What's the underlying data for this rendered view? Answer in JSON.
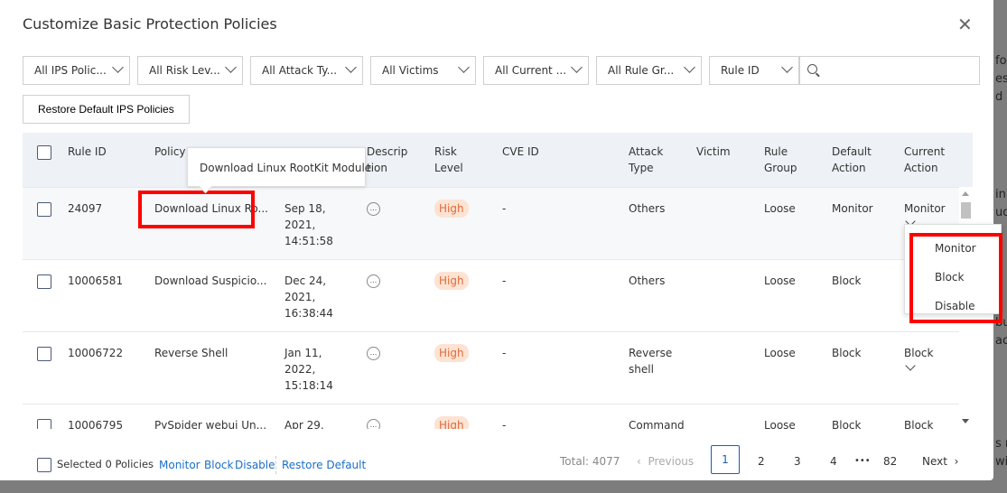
{
  "background_fragments": [
    "for",
    "es",
    "d I",
    "in",
    "ud",
    "bu",
    "ac",
    "s r",
    "wi"
  ],
  "dialog": {
    "title": "Customize Basic Protection Policies",
    "close_icon": "close-icon"
  },
  "filters": [
    "All IPS Polic...",
    "All Risk Lev...",
    "All Attack Ty...",
    "All Victims",
    "All Current ...",
    "All Rule Gr...",
    "Rule ID"
  ],
  "search": {
    "placeholder": ""
  },
  "restore_button": "Restore Default IPS Policies",
  "table": {
    "headers": {
      "rule_id": "Rule ID",
      "policy_name": "Policy N",
      "description_1": "Descrip",
      "description_2": "tion",
      "risk_1": "Risk",
      "risk_2": "Level",
      "cve": "CVE ID",
      "attack_1": "Attack",
      "attack_2": "Type",
      "victim": "Victim",
      "group_1": "Rule",
      "group_2": "Group",
      "default_1": "Default",
      "default_2": "Action",
      "current_1": "Current",
      "current_2": "Action"
    },
    "rows": [
      {
        "rule_id": "24097",
        "policy_name": "Download Linux Ro...",
        "date_1": "Sep 18,",
        "date_2": "2021,",
        "date_3": "14:51:58",
        "desc": "...",
        "risk": "High",
        "cve": "-",
        "attack_1": "Others",
        "attack_2": "",
        "victim": "",
        "group": "Loose",
        "default_action": "Monitor",
        "current_action": "Monitor"
      },
      {
        "rule_id": "10006581",
        "policy_name": "Download Suspicio...",
        "date_1": "Dec 24,",
        "date_2": "2021,",
        "date_3": "16:38:44",
        "desc": "...",
        "risk": "High",
        "cve": "-",
        "attack_1": "Others",
        "attack_2": "",
        "victim": "",
        "group": "Loose",
        "default_action": "Block",
        "current_action": ""
      },
      {
        "rule_id": "10006722",
        "policy_name": "Reverse Shell",
        "date_1": "Jan 11,",
        "date_2": "2022,",
        "date_3": "15:18:14",
        "desc": "...",
        "risk": "High",
        "cve": "-",
        "attack_1": "Reverse",
        "attack_2": "shell",
        "victim": "",
        "group": "Loose",
        "default_action": "Block",
        "current_action": "Block"
      },
      {
        "rule_id": "10006795",
        "policy_name": "PySpider webui Un...",
        "date_1": "Apr 29,",
        "date_2": "",
        "date_3": "",
        "desc": "...",
        "risk": "High",
        "cve": "-",
        "attack_1": "Command",
        "attack_2": "",
        "victim": "",
        "group": "Loose",
        "default_action": "Block",
        "current_action": "Block"
      }
    ]
  },
  "tooltip": "Download Linux RootKit Module",
  "action_dropdown": [
    "Monitor",
    "Block",
    "Disable"
  ],
  "footer": {
    "selected": "Selected 0 Policies",
    "actions": [
      "Monitor",
      "Block",
      "Disable"
    ],
    "restore": "Restore Default",
    "total": "Total: 4077",
    "previous": "Previous",
    "pages": [
      "1",
      "2",
      "3",
      "4",
      "82"
    ],
    "ellipsis": "•••",
    "next": "Next",
    "current_page": "1"
  },
  "colors": {
    "accent": "#1a5fb4",
    "link": "#1a6fc9",
    "risk_high_bg": "#fde3d3",
    "risk_high_text": "#e26a3a",
    "highlight_box": "#ff0000"
  }
}
